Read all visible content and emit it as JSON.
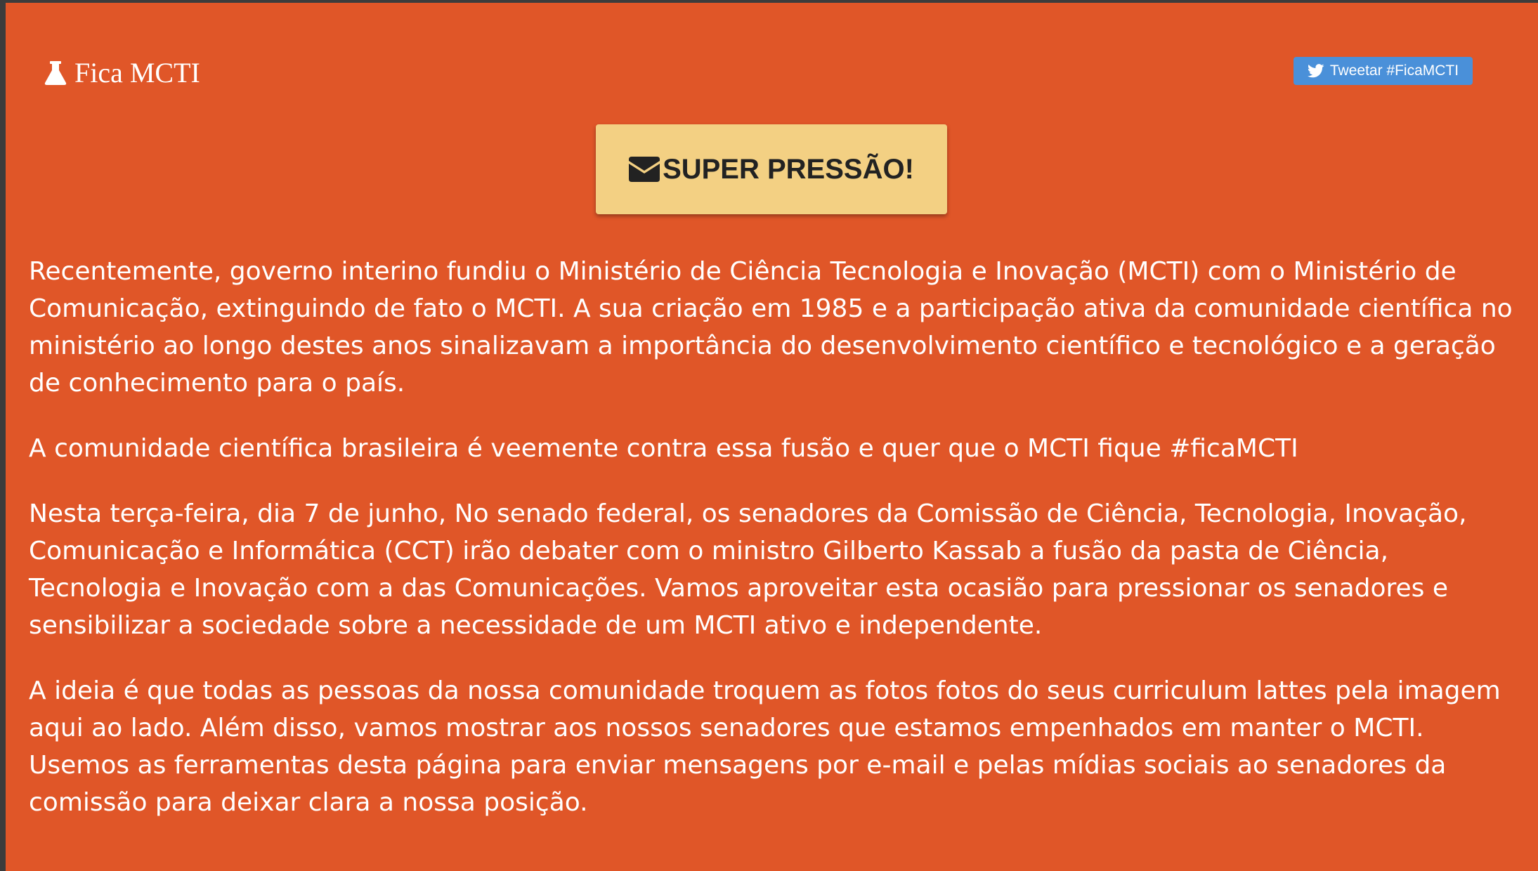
{
  "brand": {
    "title": "Fica MCTI",
    "icon": "flask-icon"
  },
  "tweet_button": {
    "label": "Tweetar #FicaMCTI",
    "icon": "twitter-bird-icon",
    "color": "#4a90d9"
  },
  "pressure_button": {
    "label": "SUPER PRESSÃO!",
    "icon": "envelope-icon",
    "color": "#f3d083"
  },
  "colors": {
    "background": "#e05628",
    "text": "#ffffff"
  },
  "paragraphs": [
    "Recentemente, governo interino fundiu o Ministério de Ciência Tecnologia e Inovação (MCTI) com o Ministério de Comunicação, extinguindo de fato o MCTI. A sua criação em 1985 e a participação ativa da comunidade científica no ministério ao longo destes anos sinalizavam a importância do desenvolvimento científico e tecnológico e a geração de conhecimento para o país.",
    "A comunidade científica brasileira é veemente contra essa fusão e quer que o MCTI fique #ficaMCTI",
    "Nesta terça-feira, dia 7 de junho, No senado federal, os senadores da Comissão de Ciência, Tecnologia, Inovação, Comunicação e Informática (CCT) irão debater com o ministro Gilberto Kassab a fusão da pasta de Ciência, Tecnologia e Inovação com a das Comunicações. Vamos aproveitar esta ocasião para pressionar os senadores e sensibilizar a sociedade sobre a necessidade de um MCTI ativo e independente.",
    "A ideia é que todas as pessoas da nossa comunidade troquem as fotos fotos do seus curriculum lattes pela imagem aqui ao lado. Além disso, vamos mostrar aos nossos senadores que estamos empenhados em manter o MCTI. Usemos as ferramentas desta página para enviar mensagens por e-mail e pelas mídias sociais ao senadores da comissão para deixar clara a nossa posição."
  ]
}
